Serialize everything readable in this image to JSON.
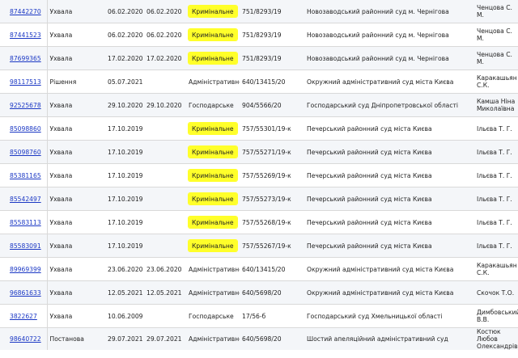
{
  "highlight_color": "#ffff2a",
  "link_color": "#1a37c4",
  "rows": [
    {
      "id": "87442270",
      "type": "Ухвала",
      "date_reg": "06.02.2020",
      "date_law": "06.02.2020",
      "form": "Кримінальне",
      "highlighted": true,
      "case_no": "751/8293/19",
      "court": "Новозаводський районний суд м. Чернігова",
      "judge": "Ченцова С. М."
    },
    {
      "id": "87441523",
      "type": "Ухвала",
      "date_reg": "06.02.2020",
      "date_law": "06.02.2020",
      "form": "Кримінальне",
      "highlighted": true,
      "case_no": "751/8293/19",
      "court": "Новозаводський районний суд м. Чернігова",
      "judge": "Ченцова С. М."
    },
    {
      "id": "87699365",
      "type": "Ухвала",
      "date_reg": "17.02.2020",
      "date_law": "17.02.2020",
      "form": "Кримінальне",
      "highlighted": true,
      "case_no": "751/8293/19",
      "court": "Новозаводський районний суд м. Чернігова",
      "judge": "Ченцова С. М."
    },
    {
      "id": "98117513",
      "type": "Рішення",
      "date_reg": "05.07.2021",
      "date_law": "",
      "form": "Адміністративне",
      "highlighted": false,
      "case_no": "640/13415/20",
      "court": "Окружний адміністративний суд міста Києва",
      "judge": "Каракашьян С.К."
    },
    {
      "id": "92525678",
      "type": "Ухвала",
      "date_reg": "29.10.2020",
      "date_law": "29.10.2020",
      "form": "Господарське",
      "highlighted": false,
      "case_no": "904/5566/20",
      "court": "Господарський суд Дніпропетровської області",
      "judge": "Камша Ніна Миколаївна"
    },
    {
      "id": "85098860",
      "type": "Ухвала",
      "date_reg": "17.10.2019",
      "date_law": "",
      "form": "Кримінальне",
      "highlighted": true,
      "case_no": "757/55301/19-к",
      "court": "Печерський районний суд міста Києва",
      "judge": "Ільєва Т. Г."
    },
    {
      "id": "85098760",
      "type": "Ухвала",
      "date_reg": "17.10.2019",
      "date_law": "",
      "form": "Кримінальне",
      "highlighted": true,
      "case_no": "757/55271/19-к",
      "court": "Печерський районний суд міста Києва",
      "judge": "Ільєва Т. Г."
    },
    {
      "id": "85381165",
      "type": "Ухвала",
      "date_reg": "17.10.2019",
      "date_law": "",
      "form": "Кримінальне",
      "highlighted": true,
      "case_no": "757/55269/19-к",
      "court": "Печерський районний суд міста Києва",
      "judge": "Ільєва Т. Г."
    },
    {
      "id": "85542497",
      "type": "Ухвала",
      "date_reg": "17.10.2019",
      "date_law": "",
      "form": "Кримінальне",
      "highlighted": true,
      "case_no": "757/55273/19-к",
      "court": "Печерський районний суд міста Києва",
      "judge": "Ільєва Т. Г."
    },
    {
      "id": "85583113",
      "type": "Ухвала",
      "date_reg": "17.10.2019",
      "date_law": "",
      "form": "Кримінальне",
      "highlighted": true,
      "case_no": "757/55268/19-к",
      "court": "Печерський районний суд міста Києва",
      "judge": "Ільєва Т. Г."
    },
    {
      "id": "85583091",
      "type": "Ухвала",
      "date_reg": "17.10.2019",
      "date_law": "",
      "form": "Кримінальне",
      "highlighted": true,
      "case_no": "757/55267/19-к",
      "court": "Печерський районний суд міста Києва",
      "judge": "Ільєва Т. Г."
    },
    {
      "id": "89969399",
      "type": "Ухвала",
      "date_reg": "23.06.2020",
      "date_law": "23.06.2020",
      "form": "Адміністративне",
      "highlighted": false,
      "case_no": "640/13415/20",
      "court": "Окружний адміністративний суд міста Києва",
      "judge": "Каракашьян С.К."
    },
    {
      "id": "96861633",
      "type": "Ухвала",
      "date_reg": "12.05.2021",
      "date_law": "12.05.2021",
      "form": "Адміністративне",
      "highlighted": false,
      "case_no": "640/5698/20",
      "court": "Окружний адміністративний суд міста Києва",
      "judge": "Скочок Т.О."
    },
    {
      "id": "3822627",
      "type": "Ухвала",
      "date_reg": "10.06.2009",
      "date_law": "",
      "form": "Господарське",
      "highlighted": false,
      "case_no": "17/56-б",
      "court": "Господарський суд Хмельницької області",
      "judge": "Димбовський В.В."
    },
    {
      "id": "98640722",
      "type": "Постанова",
      "date_reg": "29.07.2021",
      "date_law": "29.07.2021",
      "form": "Адміністративне",
      "highlighted": false,
      "case_no": "640/5698/20",
      "court": "Шостий апеляційний адміністративний суд",
      "judge": "Костюк Любов Олександрівна"
    }
  ]
}
